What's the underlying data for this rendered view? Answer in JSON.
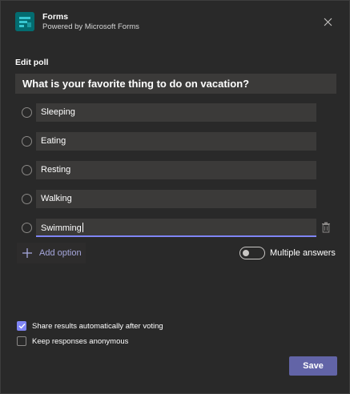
{
  "header": {
    "app_name": "Forms",
    "app_subtitle": "Powered by Microsoft Forms"
  },
  "poll": {
    "section_label": "Edit poll",
    "question": "What is your favorite thing to do on vacation?",
    "options": [
      {
        "label": "Sleeping"
      },
      {
        "label": "Eating"
      },
      {
        "label": "Resting"
      },
      {
        "label": "Walking"
      },
      {
        "label": "Swimming"
      }
    ],
    "add_option_label": "Add option"
  },
  "settings": {
    "multiple_answers_label": "Multiple answers",
    "multiple_answers_on": false,
    "share_results_label": "Share results automatically after voting",
    "share_results_checked": true,
    "anonymous_label": "Keep responses anonymous",
    "anonymous_checked": false
  },
  "footer": {
    "save_label": "Save"
  },
  "colors": {
    "background": "#292929",
    "field": "#3b3a39",
    "accent": "#6264a7",
    "accent_light": "#7f85f5",
    "brand_icon": "#036c70"
  },
  "icons": {
    "app": "forms-app-icon",
    "close": "close-icon",
    "delete": "trash-icon",
    "add": "plus-icon"
  }
}
